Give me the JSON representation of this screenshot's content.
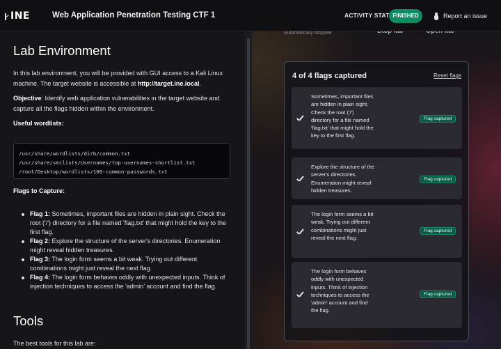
{
  "header": {
    "logo_text": "INE",
    "lab_title": "Web Application Penetration Testing CTF 1",
    "activity_label": "ACTIVITY STATUS:",
    "status": "FINISHED",
    "report_label": "Report an issue"
  },
  "left": {
    "heading": "Lab Environment",
    "intro": "In this lab environment, you will be provided with GUI access to a Kali Linux machine. The target website is accessible at ",
    "intro_url": "http://target.ine.local",
    "intro_end": ".",
    "objective_label": "Objective",
    "objective_text": ": Identify web application vulnerabilities in the target website and capture all the flags hidden within the environment.",
    "wordlists_heading": "Useful wordlists:",
    "wordlists": [
      "/usr/share/wordlists/dirb/common.txt",
      "/usr/share/seclists/Usernames/top-usernames-shortlist.txt",
      "/root/Desktop/wordlists/100-common-passwords.txt"
    ],
    "flags_heading": "Flags to Capture:",
    "flags": [
      {
        "label": "Flag 1:",
        "text": " Sometimes, important files are hidden in plain sight. Check the root ('/') directory for a file named 'flag.txt' that might hold the key to the first flag."
      },
      {
        "label": "Flag 2:",
        "text": " Explore the structure of the server's directories. Enumeration might reveal hidden treasures."
      },
      {
        "label": "Flag 3:",
        "text": " The login form seems a bit weak. Trying out different combinations might just reveal the next flag."
      },
      {
        "label": "Flag 4:",
        "text": " The login form behaves oddly with unexpected inputs. Think of injection techniques to access the 'admin' account and find the flag."
      }
    ],
    "tools_heading": "Tools",
    "tools_text": "The best tools for this lab are:"
  },
  "right": {
    "top_cut": [
      "Automatically stopped",
      "Stop lab",
      "Open lab"
    ],
    "panel_title": "4 of 4 flags captured",
    "reset_label": "Reset flags",
    "cards": [
      {
        "text": "Sometimes, important files are hidden in plain sight. Check the root ('/') directory for a file named 'flag.txt' that might hold the key to the first flag.",
        "status": "Flag captured"
      },
      {
        "text": "Explore the structure of the server's directories. Enumeration might reveal hidden treasures.",
        "status": "Flag captured"
      },
      {
        "text": "The login form seems a bit weak. Trying out different combinations might just reveal the next flag.",
        "status": "Flag captured"
      },
      {
        "text": "The login form behaves oddly with unexpected inputs. Think of injection techniques to access the 'admin' account and find the flag.",
        "status": "Flag captured"
      }
    ]
  },
  "colors": {
    "accent_green": "#0f8a62",
    "badge_green": "#0c5a44",
    "background": "#16161a"
  }
}
